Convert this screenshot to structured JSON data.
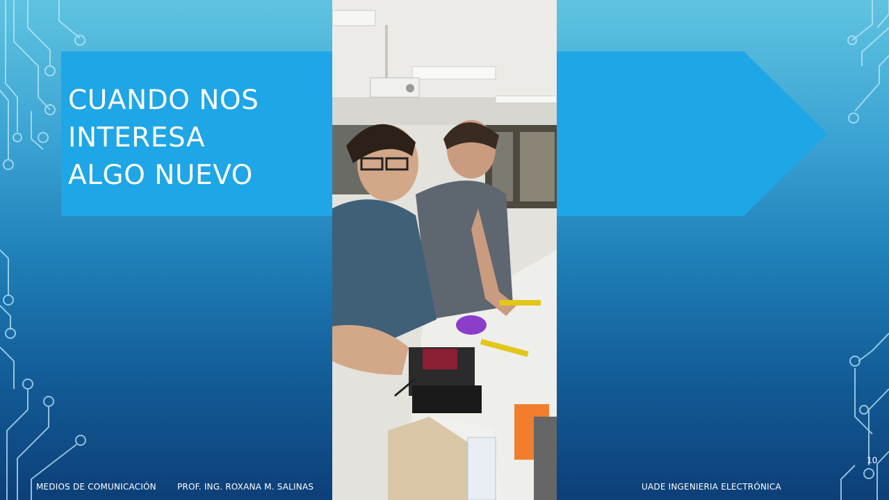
{
  "slide": {
    "title_lines": [
      "CUANDO NOS",
      "INTERESA",
      "ALGO NUEVO"
    ],
    "footer_left": "MEDIOS DE COMUNICACIÓN",
    "footer_center": "PROF. ING. ROXANA M. SALINAS",
    "footer_right": "UADE INGENIERIA ELECTRÓNICA",
    "page_number": "10"
  },
  "colors": {
    "accent_panel": "#1ea6e6",
    "text": "#ffffff"
  },
  "video": {
    "description_icon": "video-frame"
  }
}
